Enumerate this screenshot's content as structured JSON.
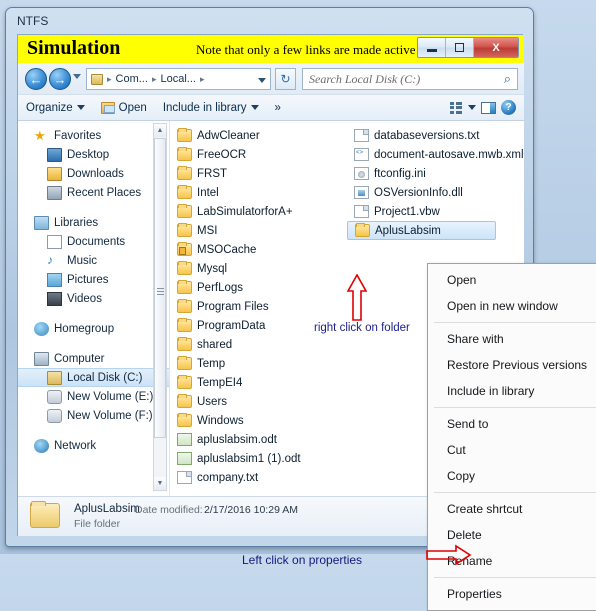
{
  "outer_window": {
    "title": "NTFS"
  },
  "banner": {
    "title": "Simulation",
    "note": "Note that only a few links are made active"
  },
  "window_controls": {
    "minimize_label": "Minimize",
    "maximize_label": "Maximize",
    "close_label": "X"
  },
  "addressbar": {
    "crumb1": "Com...",
    "crumb2": "Local...",
    "sep": "▸",
    "back_glyph": "←",
    "forward_glyph": "→",
    "refresh_glyph": "↻"
  },
  "search": {
    "placeholder": "Search Local Disk (C:)",
    "icon_glyph": "⌕"
  },
  "toolbar": {
    "organize": "Organize",
    "open": "Open",
    "include_in_library": "Include in library",
    "overflow": "»",
    "help_glyph": "?"
  },
  "navpane": {
    "groups": [
      {
        "label": "Favorites",
        "items": [
          "Desktop",
          "Downloads",
          "Recent Places"
        ]
      },
      {
        "label": "Libraries",
        "items": [
          "Documents",
          "Music",
          "Pictures",
          "Videos"
        ]
      },
      {
        "label": "Homegroup",
        "items": []
      },
      {
        "label": "Computer",
        "items": [
          "Local Disk (C:)",
          "New Volume (E:)",
          "New Volume (F:)"
        ]
      },
      {
        "label": "Network",
        "items": []
      }
    ],
    "selected": "Local Disk (C:)",
    "music_glyph": "♪",
    "scroll_up_glyph": "▲",
    "scroll_down_glyph": "▼"
  },
  "filelist": {
    "column1": [
      {
        "name": "AdwCleaner",
        "type": "folder"
      },
      {
        "name": "FreeOCR",
        "type": "folder"
      },
      {
        "name": "FRST",
        "type": "folder"
      },
      {
        "name": "Intel",
        "type": "folder"
      },
      {
        "name": "LabSimulatorforA+",
        "type": "folder"
      },
      {
        "name": "MSI",
        "type": "folder"
      },
      {
        "name": "MSOCache",
        "type": "folder-locked"
      },
      {
        "name": "Mysql",
        "type": "folder"
      },
      {
        "name": "PerfLogs",
        "type": "folder"
      },
      {
        "name": "Program Files",
        "type": "folder"
      },
      {
        "name": "ProgramData",
        "type": "folder"
      },
      {
        "name": "shared",
        "type": "folder"
      },
      {
        "name": "Temp",
        "type": "folder"
      },
      {
        "name": "TempEI4",
        "type": "folder"
      },
      {
        "name": "Users",
        "type": "folder"
      },
      {
        "name": "Windows",
        "type": "folder"
      },
      {
        "name": "apluslabsim.odt",
        "type": "odt"
      },
      {
        "name": "apluslabsim1 (1).odt",
        "type": "odt"
      },
      {
        "name": "company.txt",
        "type": "file"
      }
    ],
    "column2": [
      {
        "name": "databaseversions.txt",
        "type": "file"
      },
      {
        "name": "document-autosave.mwb.xml",
        "type": "xml"
      },
      {
        "name": "ftconfig.ini",
        "type": "ini"
      },
      {
        "name": "OSVersionInfo.dll",
        "type": "dll"
      },
      {
        "name": "Project1.vbw",
        "type": "file"
      },
      {
        "name": "AplusLabsim",
        "type": "folder",
        "selected": true
      }
    ]
  },
  "context_menu": {
    "items": [
      {
        "label": "Open"
      },
      {
        "label": "Open in new window"
      },
      {
        "separator": true
      },
      {
        "label": "Share with"
      },
      {
        "label": "Restore Previous versions"
      },
      {
        "label": "Include in library"
      },
      {
        "separator": true
      },
      {
        "label": "Send to"
      },
      {
        "label": "Cut"
      },
      {
        "label": "Copy"
      },
      {
        "separator": true
      },
      {
        "label": "Create shrtcut"
      },
      {
        "label": "Delete"
      },
      {
        "label": "Rename"
      },
      {
        "separator": true
      },
      {
        "label": "Properties"
      }
    ]
  },
  "details_pane": {
    "name": "AplusLabsim",
    "date_label": "Date modified:",
    "date_value": "2/17/2016 10:29 AM",
    "type": "File folder"
  },
  "annotations": {
    "right_click": "right click on folder",
    "left_click": "Left click on properties"
  },
  "colors": {
    "banner_yellow": "#ffff00",
    "annotation_blue": "#1b1f8c",
    "annotation_red": "#e00000",
    "selection_blue": "#cde4f8",
    "close_red": "#b93a32"
  }
}
